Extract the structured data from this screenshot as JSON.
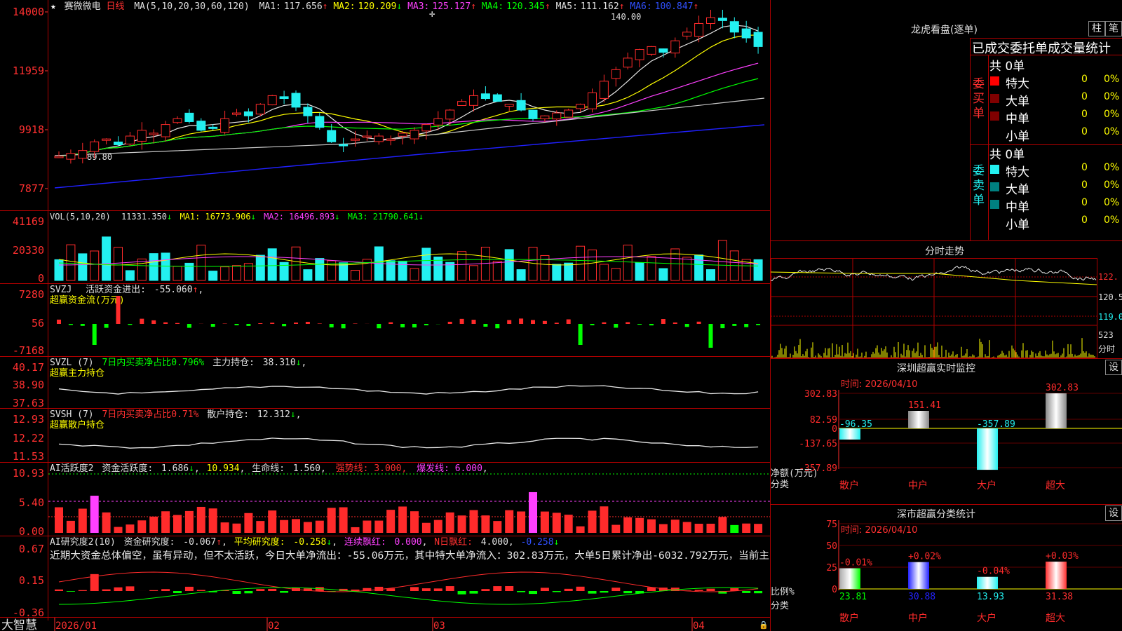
{
  "colors": {
    "up": "#ff2b2b",
    "down": "#23f0f0",
    "green": "#00ff00",
    "yellow": "#ffff00",
    "magenta": "#ff40ff",
    "white": "#e8e8e8",
    "grid": "#9b0000",
    "blue": "#2020ff"
  },
  "header": {
    "star": "★",
    "name": "赛微微电",
    "period": "日线",
    "ma_params": "MA(5,10,20,30,60,120)",
    "ma": [
      {
        "label": "MA1:",
        "value": "117.656",
        "arrow": "↑"
      },
      {
        "label": "MA2:",
        "value": "120.209",
        "arrow": "↓"
      },
      {
        "label": "MA3:",
        "value": "125.127",
        "arrow": "↑"
      },
      {
        "label": "MA4:",
        "value": "120.345",
        "arrow": "↑"
      },
      {
        "label": "MA5:",
        "value": "111.162",
        "arrow": "↑"
      },
      {
        "label": "MA6:",
        "value": "100.847",
        "arrow": "↑"
      }
    ],
    "high_label": "140.00",
    "low_label": "89.80"
  },
  "price_axis": [
    "14000",
    "11959",
    "9918",
    "7877"
  ],
  "vol": {
    "title": "VOL(5,10,20)",
    "value": "11331.350",
    "a1": "↓",
    "ma1": "MA1: 16773.906",
    "a2": "↓",
    "ma2": "MA2: 16496.893",
    "a3": "↓",
    "ma3": "MA3: 21790.641",
    "a4": "↓",
    "axis": [
      "41169",
      "20330",
      "0"
    ]
  },
  "svzj": {
    "title": "SVZJ",
    "label": "活跃资金进出:",
    "value": "-55.060",
    "arrow": "↑",
    "tail": ",",
    "sub": "超赢资金流(万元)",
    "axis": [
      "7280",
      "56",
      "-7168"
    ]
  },
  "svzl": {
    "title": "SVZL (7)",
    "label": "7日内买卖净占比0.796%",
    "label2": "主力持仓:",
    "value": "38.310",
    "arrow": "↓",
    "tail": ",",
    "sub": "超赢主力持仓",
    "axis": [
      "40.17",
      "38.90",
      "37.63"
    ]
  },
  "svsh": {
    "title": "SVSH (7)",
    "label": "7日内买卖净占比0.71%",
    "label2": "散户持仓:",
    "value": "12.312",
    "arrow": "↓",
    "tail": ",",
    "sub": "超赢散户持仓",
    "axis": [
      "12.93",
      "12.22",
      "11.53"
    ]
  },
  "ai1": {
    "title": "AI活跃度2",
    "t1": "资金活跃度:",
    "v1": "1.686",
    "a1": "↓",
    "v2": "10.934",
    "t3": "生命线:",
    "v3": "1.560",
    "strong": "强势线: 3.000",
    "burst": "爆发线: 6.000",
    "tail": ",",
    "axis": [
      "10.93",
      "5.40",
      "0.00"
    ]
  },
  "ai2": {
    "title": "AI研究度2(10)",
    "t1": "资金研究度:",
    "v1": "-0.067",
    "a1": "↑",
    "t2": "平均研究度:",
    "v2": "-0.258",
    "a2": "↓",
    "t3": "连续飘红:",
    "v3": "0.000",
    "t4": "N日飘红:",
    "v4": "4.000",
    "v5": "-0.258",
    "a5": "↓",
    "summary": "近期大资金总体偏空，虽有异动，但不太活跃，今日大单净流出：-55.06万元，其中特大单净流入：302.83万元，大单5日累计净出-6032.792万元，当前主",
    "axis": [
      "0.67",
      "0.15",
      "-0.36"
    ]
  },
  "xaxis": {
    "brand": "大智慧",
    "labels": [
      "2026/01",
      "02",
      "03",
      "04"
    ]
  },
  "dragon": {
    "title": "龙虎看盘(逐单)",
    "btn1": "柱",
    "btn2": "笔",
    "tab": "已成交委托单成交量统计",
    "buy": {
      "side": "委买单",
      "total": "共 0单",
      "rows": [
        {
          "k": "特大",
          "v": "0",
          "p": "0%"
        },
        {
          "k": "大单",
          "v": "0",
          "p": "0%"
        },
        {
          "k": "中单",
          "v": "0",
          "p": "0%"
        },
        {
          "k": "小单",
          "v": "0",
          "p": "0%"
        }
      ]
    },
    "sell": {
      "side": "委卖单",
      "total": "共 0单",
      "rows": [
        {
          "k": "特大",
          "v": "0",
          "p": "0%"
        },
        {
          "k": "大单",
          "v": "0",
          "p": "0%"
        },
        {
          "k": "中单",
          "v": "0",
          "p": "0%"
        },
        {
          "k": "小单",
          "v": "0",
          "p": "0%"
        }
      ]
    }
  },
  "fenshi": {
    "title": "分时走势",
    "axis": [
      "122.",
      "120.5",
      "119.0"
    ],
    "vol_label": "523",
    "unit": "分时"
  },
  "monitor": {
    "title": "深圳超赢实时监控",
    "btn": "设",
    "time": "时间: 2026/04/10",
    "axis": [
      "302.83",
      "82.59",
      "0",
      "-137.65",
      "-357.89"
    ],
    "ylab": "净额(万元)",
    "xlab": "分类",
    "bars": [
      {
        "cat": "散户",
        "value": -96.35,
        "label": "-96.35"
      },
      {
        "cat": "中户",
        "value": 151.41,
        "label": "151.41"
      },
      {
        "cat": "大户",
        "value": -357.89,
        "label": "-357.89"
      },
      {
        "cat": "超大",
        "value": 302.83,
        "label": "302.83"
      }
    ]
  },
  "classify": {
    "title": "深市超赢分类统计",
    "btn": "设",
    "time": "时间: 2026/04/10",
    "axis": [
      "75",
      "50",
      "25",
      "0"
    ],
    "ylab": "比例%",
    "xlab": "分类",
    "bars": [
      {
        "cat": "散户",
        "value": 23.81,
        "label": "23.81",
        "chg": "-0.01%"
      },
      {
        "cat": "中户",
        "value": 30.88,
        "label": "30.88",
        "chg": "+0.02%"
      },
      {
        "cat": "大户",
        "value": 13.93,
        "label": "13.93",
        "chg": "-0.04%"
      },
      {
        "cat": "超大",
        "value": 31.38,
        "label": "31.38",
        "chg": "+0.03%"
      }
    ]
  }
}
